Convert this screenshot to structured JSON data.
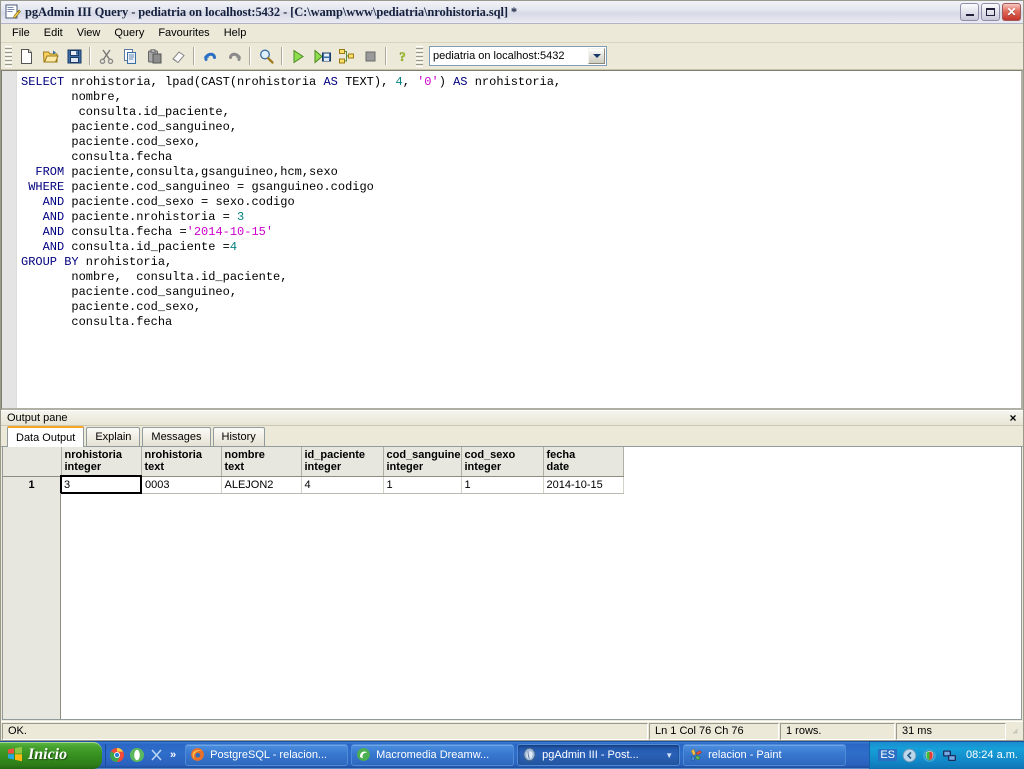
{
  "window": {
    "title": "pgAdmin III Query - pediatria on localhost:5432 - [C:\\wamp\\www\\pediatria\\nrohistoria.sql] *",
    "icon": "query-document-icon",
    "minimize_label": "Minimize",
    "maximize_label": "Maximize",
    "close_label": "Close"
  },
  "menu": {
    "items": [
      {
        "label": "File"
      },
      {
        "label": "Edit"
      },
      {
        "label": "View"
      },
      {
        "label": "Query"
      },
      {
        "label": "Favourites"
      },
      {
        "label": "Help"
      }
    ]
  },
  "toolbar": {
    "buttons": [
      {
        "name": "new-file-icon",
        "title": "New"
      },
      {
        "name": "open-file-icon",
        "title": "Open file"
      },
      {
        "name": "save-icon",
        "title": "Save"
      },
      {
        "name": "cut-icon",
        "title": "Cut"
      },
      {
        "name": "copy-icon",
        "title": "Copy"
      },
      {
        "name": "paste-icon",
        "title": "Paste"
      },
      {
        "name": "eraser-icon",
        "title": "Clear window"
      },
      {
        "name": "undo-icon",
        "title": "Undo"
      },
      {
        "name": "redo-icon",
        "title": "Redo"
      },
      {
        "name": "find-icon",
        "title": "Find"
      },
      {
        "name": "execute-icon",
        "title": "Execute query"
      },
      {
        "name": "execute-to-file-icon",
        "title": "Execute query, write result to file"
      },
      {
        "name": "explain-icon",
        "title": "Explain query"
      },
      {
        "name": "stop-icon",
        "title": "Cancel"
      },
      {
        "name": "help-icon",
        "title": "Help"
      }
    ],
    "connection": {
      "value": "pediatria on localhost:5432",
      "icon": "chevron-down-icon"
    }
  },
  "editor": {
    "lines": [
      [
        {
          "t": "kw",
          "v": "SELECT"
        },
        {
          "t": "p",
          "v": " nrohistoria, lpad(CAST(nrohistoria "
        },
        {
          "t": "kw",
          "v": "AS"
        },
        {
          "t": "p",
          "v": " TEXT), "
        },
        {
          "t": "num",
          "v": "4"
        },
        {
          "t": "p",
          "v": ", "
        },
        {
          "t": "str",
          "v": "'0'"
        },
        {
          "t": "p",
          "v": ") "
        },
        {
          "t": "kw",
          "v": "AS"
        },
        {
          "t": "p",
          "v": " nrohistoria,"
        }
      ],
      [
        {
          "t": "p",
          "v": "       nombre,"
        }
      ],
      [
        {
          "t": "p",
          "v": "        consulta.id_paciente,"
        }
      ],
      [
        {
          "t": "p",
          "v": "       paciente.cod_sanguineo,"
        }
      ],
      [
        {
          "t": "p",
          "v": "       paciente.cod_sexo,"
        }
      ],
      [
        {
          "t": "p",
          "v": "       consulta.fecha"
        }
      ],
      [
        {
          "t": "kw",
          "v": "  FROM"
        },
        {
          "t": "p",
          "v": " paciente,consulta,gsanguineo,hcm,sexo"
        }
      ],
      [
        {
          "t": "kw",
          "v": " WHERE"
        },
        {
          "t": "p",
          "v": " paciente.cod_sanguineo = gsanguineo.codigo"
        }
      ],
      [
        {
          "t": "kw",
          "v": "   AND"
        },
        {
          "t": "p",
          "v": " paciente.cod_sexo = sexo.codigo"
        }
      ],
      [
        {
          "t": "kw",
          "v": "   AND"
        },
        {
          "t": "p",
          "v": " paciente.nrohistoria = "
        },
        {
          "t": "num",
          "v": "3"
        }
      ],
      [
        {
          "t": "kw",
          "v": "   AND"
        },
        {
          "t": "p",
          "v": " consulta.fecha ="
        },
        {
          "t": "str",
          "v": "'2014-10-15'"
        }
      ],
      [
        {
          "t": "kw",
          "v": "   AND"
        },
        {
          "t": "p",
          "v": " consulta.id_paciente ="
        },
        {
          "t": "num",
          "v": "4"
        }
      ],
      [
        {
          "t": "kw",
          "v": "GROUP BY"
        },
        {
          "t": "p",
          "v": " nrohistoria,"
        }
      ],
      [
        {
          "t": "p",
          "v": "       nombre,  consulta.id_paciente,"
        }
      ],
      [
        {
          "t": "p",
          "v": "       paciente.cod_sanguineo,"
        }
      ],
      [
        {
          "t": "p",
          "v": "       paciente.cod_sexo,"
        }
      ],
      [
        {
          "t": "p",
          "v": "       consulta.fecha"
        }
      ]
    ],
    "colors": {
      "keyword": "#00007f",
      "number": "#007f7f",
      "string": "#cc00cc",
      "plain": "#000000"
    }
  },
  "output_pane": {
    "header_label": "Output pane",
    "close_icon": "close-icon",
    "close_glyph": "×",
    "tabs": [
      {
        "label": "Data Output",
        "active": true
      },
      {
        "label": "Explain",
        "active": false
      },
      {
        "label": "Messages",
        "active": false
      },
      {
        "label": "History",
        "active": false
      }
    ],
    "grid": {
      "columns": [
        {
          "name": "nrohistoria",
          "type": "integer"
        },
        {
          "name": "nrohistoria",
          "type": "text"
        },
        {
          "name": "nombre",
          "type": "text"
        },
        {
          "name": "id_paciente",
          "type": "integer"
        },
        {
          "name": "cod_sanguine",
          "type": "integer"
        },
        {
          "name": "cod_sexo",
          "type": "integer"
        },
        {
          "name": "fecha",
          "type": "date"
        }
      ],
      "rows": [
        {
          "num": "1",
          "cells": [
            "3",
            "0003",
            "ALEJON2",
            "4",
            "1",
            "1",
            "2014-10-15"
          ],
          "selected_index": 0
        }
      ]
    }
  },
  "status_bar": {
    "status": "OK.",
    "position": "Ln 1 Col 76 Ch 76",
    "rows": "1 rows.",
    "time": "31 ms"
  },
  "taskbar": {
    "start_label": "Inicio",
    "start_icon": "windows-flag-icon",
    "quick_launch": [
      {
        "name": "chrome-icon"
      },
      {
        "name": "opera-icon"
      },
      {
        "name": "scissors-icon"
      }
    ],
    "quick_launch_more": "»",
    "tasks": [
      {
        "label": "PostgreSQL - relacion...",
        "icon": "firefox-icon",
        "active": false
      },
      {
        "label": "Macromedia Dreamw...",
        "icon": "dreamweaver-icon",
        "active": false
      },
      {
        "label": "pgAdmin III - Post...",
        "icon": "pgadmin-icon",
        "active": true,
        "has_group_arrow": true
      },
      {
        "label": "relacion - Paint",
        "icon": "paint-icon",
        "active": false
      }
    ],
    "tray": {
      "language": "ES",
      "icons": [
        {
          "name": "show-hidden-icons-icon"
        },
        {
          "name": "security-shield-icon"
        },
        {
          "name": "network-icon"
        }
      ],
      "clock": "08:24 a.m."
    }
  }
}
